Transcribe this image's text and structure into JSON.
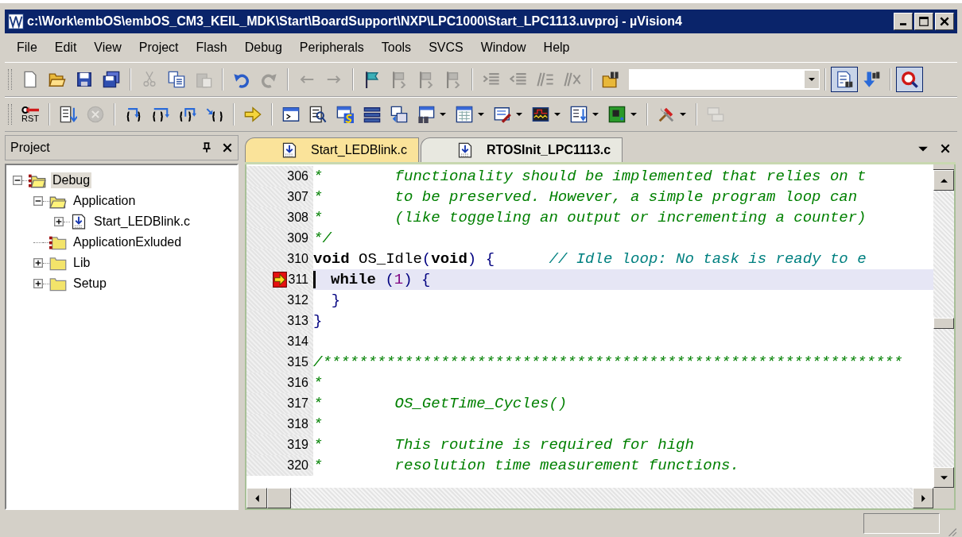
{
  "window": {
    "title": "c:\\Work\\embOS\\embOS_CM3_KEIL_MDK\\Start\\BoardSupport\\NXP\\LPC1000\\Start_LPC1113.uvproj - µVision4"
  },
  "menu": [
    {
      "label": "File"
    },
    {
      "label": "Edit"
    },
    {
      "label": "View"
    },
    {
      "label": "Project"
    },
    {
      "label": "Flash"
    },
    {
      "label": "Debug"
    },
    {
      "label": "Peripherals"
    },
    {
      "label": "Tools"
    },
    {
      "label": "SVCS"
    },
    {
      "label": "Window"
    },
    {
      "label": "Help"
    }
  ],
  "toolbar_1": [
    [
      {
        "disabled": false,
        "pressed": false,
        "dropdown": false
      },
      {
        "disabled": false,
        "pressed": false,
        "dropdown": false
      },
      {
        "disabled": false,
        "pressed": false,
        "dropdown": false
      },
      {
        "disabled": false,
        "pressed": false,
        "dropdown": false
      }
    ],
    [
      {
        "disabled": true,
        "pressed": false,
        "dropdown": false
      },
      {
        "disabled": false,
        "pressed": false,
        "dropdown": false
      },
      {
        "disabled": true,
        "pressed": false,
        "dropdown": false
      }
    ],
    [
      {
        "disabled": false,
        "pressed": false,
        "dropdown": false
      },
      {
        "disabled": true,
        "pressed": false,
        "dropdown": false
      }
    ],
    [
      {
        "disabled": true,
        "pressed": false,
        "dropdown": false
      },
      {
        "disabled": true,
        "pressed": false,
        "dropdown": false
      }
    ],
    [
      {
        "disabled": false,
        "pressed": false,
        "dropdown": false
      },
      {
        "disabled": true,
        "pressed": false,
        "dropdown": false
      },
      {
        "disabled": true,
        "pressed": false,
        "dropdown": false
      },
      {
        "disabled": true,
        "pressed": false,
        "dropdown": false
      }
    ],
    [
      {
        "disabled": true,
        "pressed": false,
        "dropdown": false
      },
      {
        "disabled": true,
        "pressed": false,
        "dropdown": false
      },
      {
        "disabled": true,
        "pressed": false,
        "dropdown": false
      },
      {
        "disabled": true,
        "pressed": false,
        "dropdown": false
      }
    ],
    [
      {
        "disabled": false,
        "pressed": false,
        "dropdown": false
      }
    ],
    [
      {
        "disabled": false,
        "pressed": true,
        "dropdown": false
      },
      {
        "disabled": false,
        "pressed": false,
        "dropdown": false
      }
    ],
    [
      {
        "disabled": false,
        "pressed": true,
        "dropdown": false
      }
    ]
  ],
  "toolbar_2": [
    [
      {
        "disabled": false,
        "pressed": false,
        "dropdown": false,
        "label": "RST"
      }
    ],
    [
      {
        "disabled": false,
        "pressed": false,
        "dropdown": false
      },
      {
        "disabled": true,
        "pressed": false,
        "dropdown": false
      }
    ],
    [
      {
        "disabled": false,
        "pressed": false,
        "dropdown": false
      },
      {
        "disabled": false,
        "pressed": false,
        "dropdown": false
      },
      {
        "disabled": false,
        "pressed": false,
        "dropdown": false
      },
      {
        "disabled": false,
        "pressed": false,
        "dropdown": false
      }
    ],
    [
      {
        "disabled": false,
        "pressed": false,
        "dropdown": false
      }
    ],
    [
      {
        "disabled": false,
        "pressed": false,
        "dropdown": false
      },
      {
        "disabled": false,
        "pressed": false,
        "dropdown": false
      },
      {
        "disabled": false,
        "pressed": false,
        "dropdown": false
      },
      {
        "disabled": false,
        "pressed": false,
        "dropdown": false
      },
      {
        "disabled": false,
        "pressed": false,
        "dropdown": false
      },
      {
        "disabled": false,
        "pressed": false,
        "dropdown": true
      },
      {
        "disabled": false,
        "pressed": false,
        "dropdown": true
      },
      {
        "disabled": false,
        "pressed": false,
        "dropdown": true
      },
      {
        "disabled": false,
        "pressed": false,
        "dropdown": true
      },
      {
        "disabled": false,
        "pressed": false,
        "dropdown": true
      },
      {
        "disabled": false,
        "pressed": false,
        "dropdown": true
      }
    ],
    [
      {
        "disabled": false,
        "pressed": false,
        "dropdown": true
      }
    ],
    [
      {
        "disabled": true,
        "pressed": false,
        "dropdown": false
      }
    ]
  ],
  "project": {
    "title": "Project",
    "tree": [
      {
        "label": "Debug",
        "kind": "target",
        "expandable": true,
        "expanded": true,
        "selected": true,
        "children": [
          {
            "label": "Application",
            "kind": "folder",
            "expandable": true,
            "expanded": true,
            "selected": false,
            "children": [
              {
                "label": "Start_LEDBlink.c",
                "kind": "file",
                "expandable": true,
                "expanded": false,
                "selected": false
              }
            ]
          },
          {
            "label": "ApplicationExluded",
            "kind": "excluded",
            "expandable": false,
            "selected": false
          },
          {
            "label": "Lib",
            "kind": "folder",
            "expandable": true,
            "expanded": false,
            "selected": false
          },
          {
            "label": "Setup",
            "kind": "folder",
            "expandable": true,
            "expanded": false,
            "selected": false
          }
        ]
      }
    ]
  },
  "editor": {
    "tabs": [
      {
        "label": "Start_LEDBlink.c",
        "selected": false
      },
      {
        "label": "RTOSInit_LPC1113.c",
        "selected": true
      }
    ],
    "lines": [
      {
        "number": "306",
        "current": false,
        "segments": [
          {
            "kind": "comment",
            "text": "*        functionality should be implemented that relies on t"
          }
        ]
      },
      {
        "number": "307",
        "current": false,
        "segments": [
          {
            "kind": "comment",
            "text": "*        to be preserved. However, a simple program loop can"
          }
        ]
      },
      {
        "number": "308",
        "current": false,
        "segments": [
          {
            "kind": "comment",
            "text": "*        (like toggeling an output or incrementing a counter)"
          }
        ]
      },
      {
        "number": "309",
        "current": false,
        "segments": [
          {
            "kind": "comment",
            "text": "*/"
          }
        ]
      },
      {
        "number": "310",
        "current": false,
        "segments": [
          {
            "kind": "keyword",
            "text": "void"
          },
          {
            "kind": "plain",
            "text": " OS_Idle"
          },
          {
            "kind": "punct",
            "text": "("
          },
          {
            "kind": "keyword",
            "text": "void"
          },
          {
            "kind": "punct",
            "text": ") {"
          },
          {
            "kind": "line_comment",
            "text": "      // Idle loop: No task is ready to e"
          }
        ]
      },
      {
        "number": "311",
        "current": true,
        "segments": [
          {
            "kind": "keyword",
            "text": "while"
          },
          {
            "kind": "punct",
            "text": " ("
          },
          {
            "kind": "number",
            "text": "1"
          },
          {
            "kind": "punct",
            "text": ") {"
          }
        ]
      },
      {
        "number": "312",
        "current": false,
        "segments": [
          {
            "kind": "punct",
            "text": "  }"
          }
        ]
      },
      {
        "number": "313",
        "current": false,
        "segments": [
          {
            "kind": "punct",
            "text": "}"
          }
        ]
      },
      {
        "number": "314",
        "current": false
      },
      {
        "number": "315",
        "current": false,
        "segments": [
          {
            "kind": "comment",
            "text": "/****************************************************************"
          }
        ]
      },
      {
        "number": "316",
        "current": false,
        "segments": [
          {
            "kind": "comment",
            "text": "*"
          }
        ]
      },
      {
        "number": "317",
        "current": false,
        "segments": [
          {
            "kind": "comment",
            "text": "*        OS_GetTime_Cycles()"
          }
        ]
      },
      {
        "number": "318",
        "current": false,
        "segments": [
          {
            "kind": "comment",
            "text": "*"
          }
        ]
      },
      {
        "number": "319",
        "current": false,
        "segments": [
          {
            "kind": "comment",
            "text": "*        This routine is required for high"
          }
        ]
      },
      {
        "number": "320",
        "current": false,
        "segments": [
          {
            "kind": "comment",
            "text": "*        resolution time measurement functions."
          }
        ]
      }
    ]
  }
}
